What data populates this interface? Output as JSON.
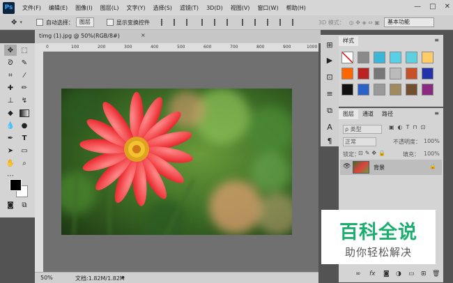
{
  "app": {
    "logo": "Ps"
  },
  "menu": [
    "文件(F)",
    "编辑(E)",
    "图像(I)",
    "图层(L)",
    "文字(Y)",
    "选择(S)",
    "滤镜(T)",
    "3D(D)",
    "视图(V)",
    "窗口(W)",
    "帮助(H)"
  ],
  "window_controls": {
    "min": "—",
    "max": "□",
    "close": "✕"
  },
  "options": {
    "auto_select_label": "自动选择：",
    "auto_select_value": "图层",
    "transform_label": "显示变换控件",
    "mode3d_label": "3D 模式：",
    "workspace": "基本功能"
  },
  "document": {
    "tab_label": "timg (1).jpg @ 50%(RGB/8#)",
    "close": "×",
    "ruler_ticks": [
      "0",
      "100",
      "200",
      "300",
      "400",
      "500",
      "600",
      "700",
      "800",
      "900",
      "1000"
    ],
    "zoom": "50%",
    "doc_info": "文档:1.82M/1.82M"
  },
  "styles_panel": {
    "tab": "样式",
    "swatch_colors": [
      "#ffffff",
      "#8a8a8a",
      "#39b6d8",
      "#57d0e8",
      "#5fd0e0",
      "#ffcc66",
      "#ff6600",
      "#bb2222",
      "#777777",
      "#bbbbbb",
      "#c85028",
      "#2233aa",
      "#111111",
      "#2a62c8",
      "#9a9a9a",
      "#a08a60",
      "#705030",
      "#8a2a80"
    ]
  },
  "layers_panel": {
    "tabs": [
      "图层",
      "通道",
      "路径"
    ],
    "filter_label": "ρ 类型",
    "blend_mode": "正常",
    "opacity_label": "不透明度：",
    "opacity_value": "100%",
    "lock_label": "锁定：",
    "fill_label": "填充：",
    "fill_value": "100%",
    "layer_name": "背景"
  },
  "watermark": {
    "title": "百科全说",
    "subtitle": "助你轻松解决"
  }
}
